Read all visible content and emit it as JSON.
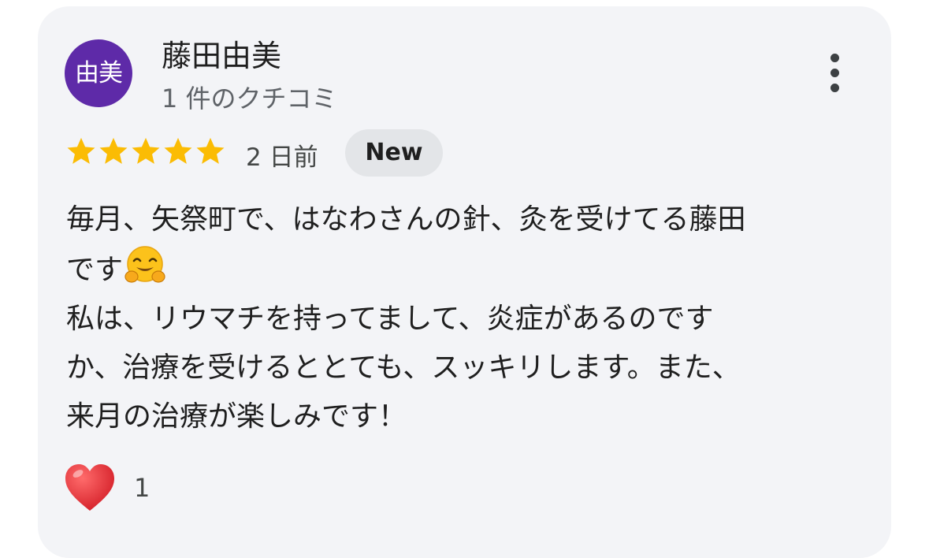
{
  "review": {
    "avatar_text": "由美",
    "author_name": "藤田由美",
    "review_count_text": "1 件のクチコミ",
    "rating": 5,
    "rating_max": 5,
    "time_ago": "2 日前",
    "badge": "New",
    "body_lines": [
      "毎月、矢祭町で、はなわさんの針、灸を受けてる藤田",
      "です",
      "私は、リウマチを持ってまして、炎症があるのです",
      "か、治療を受けるととても、スッキリします。また、",
      "来月の治療が楽しみです！"
    ],
    "reaction_count": "1"
  },
  "colors": {
    "card_background": "#f3f4f7",
    "avatar_background": "#5e2aa8",
    "star": "#fbbc04",
    "badge_background": "#e3e5e8",
    "heart": "#e0262f"
  },
  "icons": {
    "more": "more-vert-icon",
    "star": "star-icon",
    "emoji": "hugging-face-emoji",
    "reaction": "heart-icon"
  }
}
